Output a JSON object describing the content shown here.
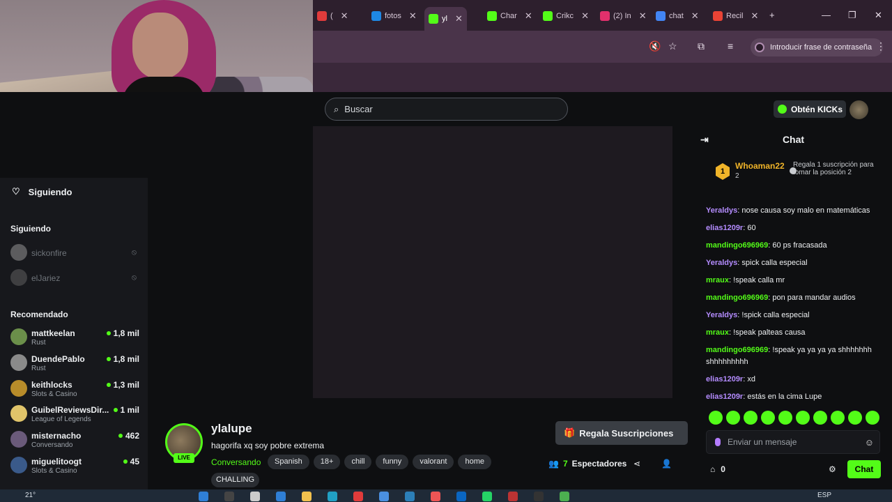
{
  "browser": {
    "tabs": [
      {
        "label": "(",
        "color": "#e03b3b"
      },
      {
        "label": "fotos",
        "color": "#1e88e5"
      },
      {
        "label": "yl",
        "color": "#53fc18"
      },
      {
        "label": "Char",
        "color": "#53fc18"
      },
      {
        "label": "Crikc",
        "color": "#53fc18"
      },
      {
        "label": "(2) In",
        "color": "#e1306c"
      },
      {
        "label": "chat",
        "color": "#4285f4"
      },
      {
        "label": "Recil",
        "color": "#ea4335"
      }
    ],
    "password_prompt": "Introducir frase de contraseña"
  },
  "header": {
    "search_placeholder": "Buscar",
    "kicks_label": "Obtén KICKs"
  },
  "sidebar": {
    "title": "Siguiendo",
    "following_section": "Siguiendo",
    "following": [
      {
        "name": "sickonfire"
      },
      {
        "name": "elJariez"
      }
    ],
    "recommended_section": "Recomendado",
    "recommended": [
      {
        "name": "mattkeelan",
        "category": "Rust",
        "viewers": "1,8 mil",
        "color": "#6b8f4a"
      },
      {
        "name": "DuendePablo",
        "category": "Rust",
        "viewers": "1,8 mil",
        "color": "#8a8a8a"
      },
      {
        "name": "keithlocks",
        "category": "Slots & Casino",
        "viewers": "1,3 mil",
        "color": "#b88c2a"
      },
      {
        "name": "GuibelReviewsDir...",
        "category": "League of Legends",
        "viewers": "1 mil",
        "color": "#e0c46a"
      },
      {
        "name": "misternacho",
        "category": "Conversando",
        "viewers": "462",
        "color": "#6a5a7a"
      },
      {
        "name": "miguelitoogt",
        "category": "Slots & Casino",
        "viewers": "45",
        "color": "#3a5a8a"
      }
    ]
  },
  "stream": {
    "streamer": "ylalupe",
    "title": "hagorifa xq soy pobre extrema",
    "live": "LIVE",
    "category": "Conversando",
    "tags": [
      "Spanish",
      "18+",
      "chill",
      "funny",
      "valorant",
      "home"
    ],
    "tag_extra": "CHALLING",
    "gift_label": "Regala Suscripciones",
    "viewers_count": "7",
    "viewers_label": "Espectadores"
  },
  "chat": {
    "title": "Chat",
    "pinned": {
      "name": "Whoaman22",
      "rank": "1",
      "count": "2",
      "gift_rank": "2",
      "gift_text": "Regala 1 suscripción para tomar la posición 2"
    },
    "messages": [
      {
        "user": "Yeraldys",
        "text": "nose causa soy malo en matemáticas",
        "color": "#b48cff"
      },
      {
        "user": "elias1209r",
        "text": "60",
        "color": "#b48cff"
      },
      {
        "user": "mandingo696969",
        "text": "60 ps fracasada",
        "color": "#53fc18"
      },
      {
        "user": "Yeraldys",
        "text": "spick calla especial",
        "color": "#b48cff"
      },
      {
        "user": "mraux",
        "text": "!speak calla mr",
        "color": "#53fc18"
      },
      {
        "user": "mandingo696969",
        "text": "pon para mandar audios",
        "color": "#53fc18"
      },
      {
        "user": "Yeraldys",
        "text": "!spick calla especial",
        "color": "#b48cff"
      },
      {
        "user": "mraux",
        "text": "!speak palteas causa",
        "color": "#53fc18"
      },
      {
        "user": "mandingo696969",
        "text": "!speak ya ya ya ya shhhhhhh shhhhhhhhh",
        "color": "#53fc18"
      },
      {
        "user": "elias1209r",
        "text": "xd",
        "color": "#b48cff"
      },
      {
        "user": "elias1209r",
        "text": "estás en la cima Lupe",
        "color": "#b48cff"
      }
    ],
    "input_placeholder": "Enviar un mensaje",
    "points": "0",
    "send_label": "Chat"
  },
  "taskbar": {
    "temperature": "21°",
    "language": "ESP"
  },
  "colors": {
    "kick_green": "#53fc18",
    "gold": "#f0b429",
    "purple_user": "#b48cff"
  }
}
